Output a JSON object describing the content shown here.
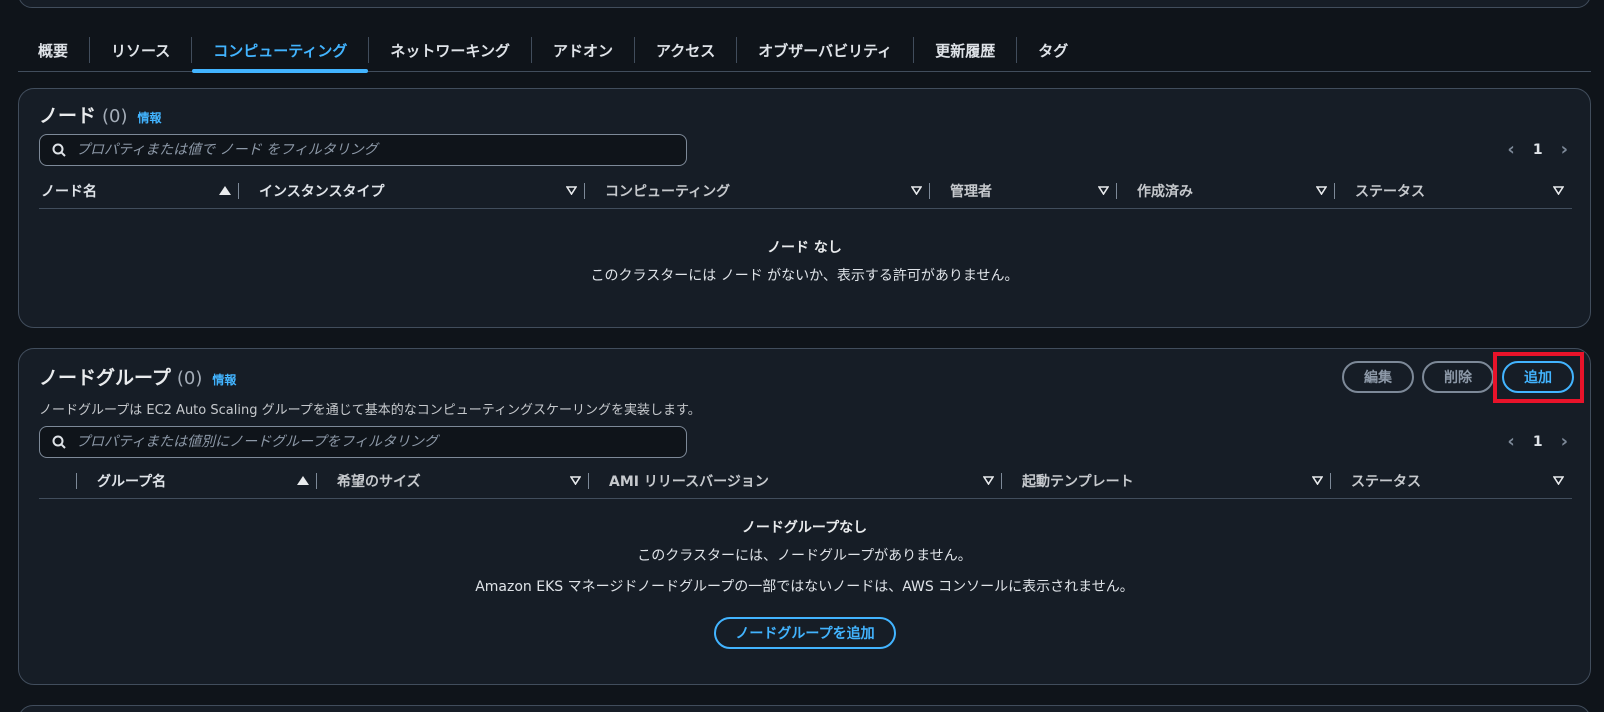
{
  "tabs": [
    {
      "label": "概要"
    },
    {
      "label": "リソース"
    },
    {
      "label": "コンピューティング",
      "active": true
    },
    {
      "label": "ネットワーキング"
    },
    {
      "label": "アドオン"
    },
    {
      "label": "アクセス"
    },
    {
      "label": "オブザーバビリティ"
    },
    {
      "label": "更新履歴"
    },
    {
      "label": "タグ"
    }
  ],
  "nodes": {
    "title": "ノード",
    "count": "(0)",
    "info": "情報",
    "search_placeholder": "プロパティまたは値で ノード をフィルタリング",
    "page": "1",
    "columns": [
      "ノード名",
      "インスタンスタイプ",
      "コンピューティング",
      "管理者",
      "作成済み",
      "ステータス"
    ],
    "empty_title": "ノード なし",
    "empty_text": "このクラスターには ノード がないか、表示する許可がありません。"
  },
  "nodegroups": {
    "title": "ノードグループ",
    "count": "(0)",
    "info": "情報",
    "description": "ノードグループは EC2 Auto Scaling グループを通じて基本的なコンピューティングスケーリングを実装します。",
    "edit_label": "編集",
    "delete_label": "削除",
    "add_label": "追加",
    "search_placeholder": "プロパティまたは値別にノードグループをフィルタリング",
    "page": "1",
    "columns": [
      "グループ名",
      "希望のサイズ",
      "AMI リリースバージョン",
      "起動テンプレート",
      "ステータス"
    ],
    "empty_title": "ノードグループなし",
    "empty_text": "このクラスターには、ノードグループがありません。",
    "empty_note": "Amazon EKS マネージドノードグループの一部ではないノードは、AWS コンソールに表示されません。",
    "add_nodegroup_label": "ノードグループを追加"
  },
  "colors": {
    "accent": "#42b4ff",
    "highlight": "#e8132a",
    "background": "#0f141a",
    "card": "#161d26"
  }
}
